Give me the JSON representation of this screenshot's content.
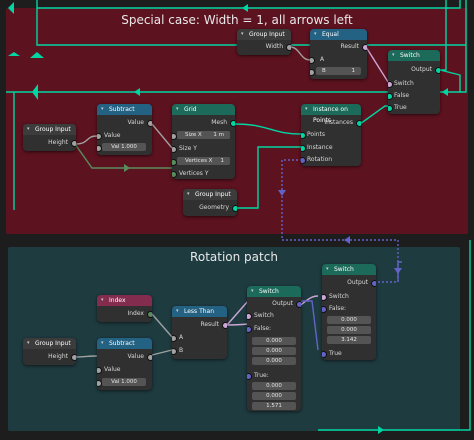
{
  "frames": {
    "top": {
      "title": "Special case: Width = 1, all arrows left",
      "color": "#5d1220"
    },
    "bottom": {
      "title": "Rotation patch",
      "color": "#1e3b40"
    }
  },
  "nodes": {
    "gi_width": {
      "title": "Group Input",
      "out": "Width"
    },
    "equal": {
      "title": "Equal",
      "out": "Result",
      "a": "A",
      "b": "B",
      "b_val": "1"
    },
    "switch1": {
      "title": "Switch",
      "out": "Output",
      "in1": "Switch",
      "in2": "False",
      "in3": "True"
    },
    "gi_height": {
      "title": "Group Input",
      "out": "Height"
    },
    "subtract1": {
      "title": "Subtract",
      "out": "Value",
      "in1": "Value",
      "val_label": "Val",
      "val": "1.000"
    },
    "grid": {
      "title": "Grid",
      "out": "Mesh",
      "sx_label": "Size X",
      "sx": "1 m",
      "sy": "Size Y",
      "vx_label": "Vertices X",
      "vx": "1",
      "vy": "Vertices Y"
    },
    "iop": {
      "title": "Instance on Points",
      "out": "Instances",
      "in1": "Points",
      "in2": "Instance",
      "in3": "Rotation"
    },
    "gi_geom": {
      "title": "Group Input",
      "out": "Geometry"
    },
    "index": {
      "title": "Index",
      "out": "Index"
    },
    "lessthan": {
      "title": "Less Than",
      "out": "Result",
      "a": "A",
      "b": "B"
    },
    "switch2": {
      "title": "Switch",
      "out": "Output",
      "in1": "Switch",
      "false": "False:",
      "f1": "0.000",
      "f2": "0.000",
      "f3": "0.000",
      "true": "True:",
      "t1": "0.000",
      "t2": "0.000",
      "t3": "1.571"
    },
    "switch3": {
      "title": "Switch",
      "out": "Output",
      "in1": "Switch",
      "false": "False:",
      "f1": "0.000",
      "f2": "0.000",
      "f3": "3.142",
      "true": "True"
    },
    "gi_height2": {
      "title": "Group Input",
      "out": "Height"
    },
    "subtract2": {
      "title": "Subtract",
      "out": "Value",
      "in1": "Value",
      "val_label": "Val",
      "val": "1.000"
    }
  },
  "colors": {
    "geometry_link": "#00d6a3",
    "float_link": "#a1a1a1",
    "int_link": "#598c5c",
    "vector_link": "#6363c7",
    "bool_link": "#cca6d6"
  }
}
